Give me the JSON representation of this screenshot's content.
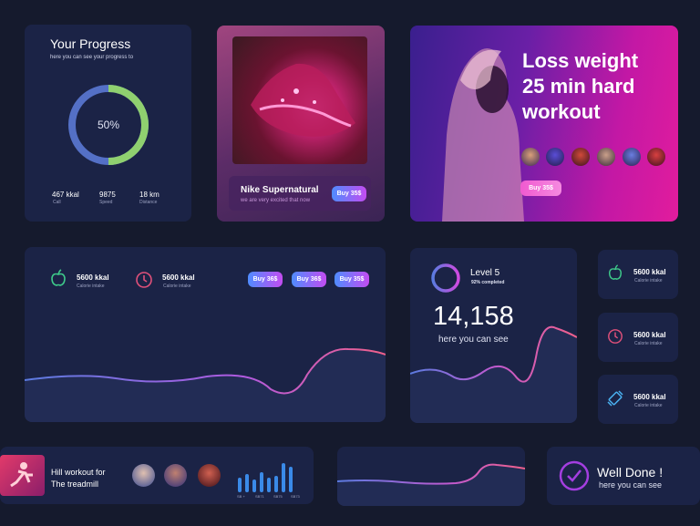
{
  "progress": {
    "title": "Your Progress",
    "subtitle": "here you can see your progress to",
    "percent_label": "50%",
    "percent": 50,
    "stats": [
      {
        "value": "467 kkal",
        "label": "Call"
      },
      {
        "value": "9875",
        "label": "Speed"
      },
      {
        "value": "18 km",
        "label": "Distance"
      }
    ]
  },
  "product": {
    "name": "Nike Supernatural",
    "tagline": "we are very excited that now",
    "buy": "Buy 35$"
  },
  "promo": {
    "line1": "Loss weight",
    "line2": "25 min hard",
    "line3": "workout",
    "buy": "Buy 35$"
  },
  "activity": {
    "stats": [
      {
        "value": "5600 kkal",
        "label": "Calorie intake",
        "icon": "apple-icon"
      },
      {
        "value": "5600 kkal",
        "label": "Calorie intake",
        "icon": "clock-icon"
      }
    ],
    "buttons": [
      "Buy 36$",
      "Buy 36$",
      "Buy 35$"
    ]
  },
  "level": {
    "title": "Level 5",
    "subtitle": "92% completed",
    "progress": 0.92,
    "value": "14,158",
    "caption": "here you can see"
  },
  "mini": [
    {
      "value": "5600 kkal",
      "label": "Calorie intake",
      "icon": "apple-icon"
    },
    {
      "value": "5600 kkal",
      "label": "Calorie intake",
      "icon": "clock-icon"
    },
    {
      "value": "5600 kkal",
      "label": "Calorie intake",
      "icon": "dumbbell-icon"
    }
  ],
  "workout": {
    "line1": "Hill workout for",
    "line2": "The treadmill",
    "axis": [
      "SB +",
      "SB71",
      "SB75",
      "SB73"
    ]
  },
  "done": {
    "title": "Well Done !",
    "caption": "here you can see"
  },
  "colors": {
    "background": "#151a2d",
    "card": "#1b2346",
    "green": "#8fd06f",
    "blue": "#5470c6",
    "pink": "#ee4d8c",
    "purple": "#a43ee0"
  }
}
